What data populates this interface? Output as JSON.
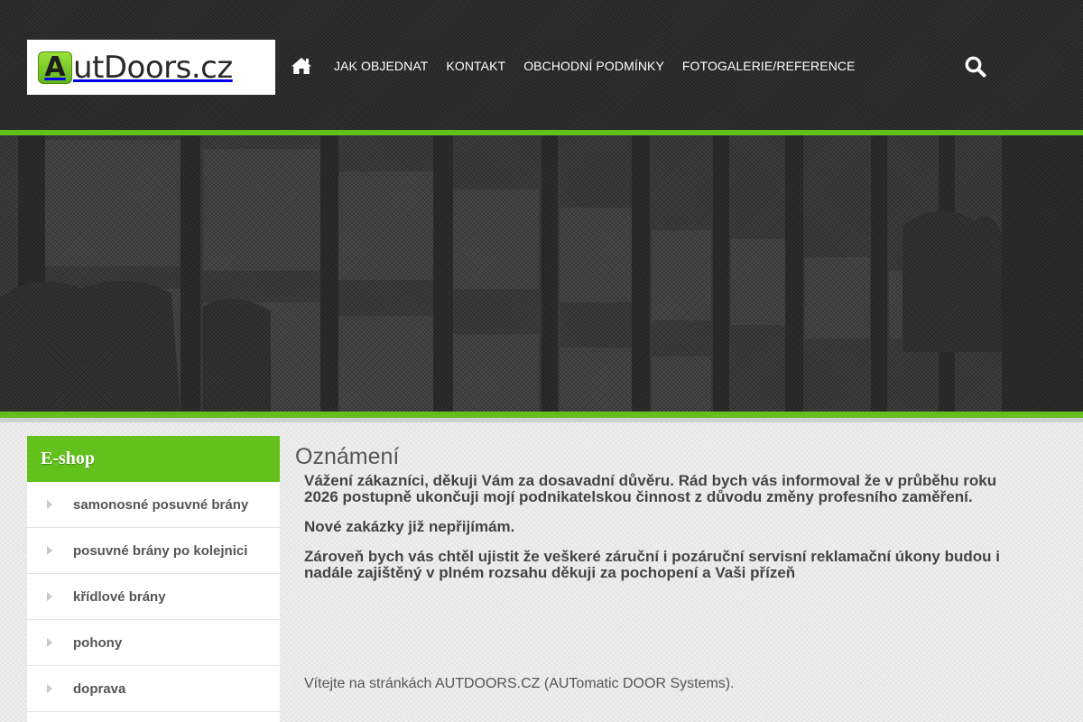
{
  "header": {
    "logo_letter": "A",
    "logo_text": "utDoors.cz",
    "nav": [
      {
        "label": "JAK OBJEDNAT"
      },
      {
        "label": "KONTAKT"
      },
      {
        "label": "OBCHODNÍ PODMÍNKY"
      },
      {
        "label": "FOTOGALERIE/REFERENCE"
      }
    ],
    "icons": {
      "home": "home-icon",
      "search": "search-icon"
    }
  },
  "sidebar": {
    "title": "E-shop",
    "items": [
      {
        "label": "samonosné posuvné brány"
      },
      {
        "label": "posuvné brány po kolejnici"
      },
      {
        "label": "křídlové brány"
      },
      {
        "label": "pohony"
      },
      {
        "label": "doprava"
      },
      {
        "label": ""
      }
    ]
  },
  "main": {
    "title": "Oznámení",
    "paragraphs": [
      "Vážení zákazníci, děkuji Vám za dosavadní důvěru. Rád bych vás informoval že v průběhu roku 2026 postupně ukončuji mojí podnikatelskou činnost z důvodu změny profesního zaměření.",
      "Nové zakázky již nepřijímám.",
      "Zároveň bych vás chtěl ujistit že veškeré záruční i pozáruční servisní reklamační úkony budou i nadále zajištěný v plném rozsahu děkuji za pochopení a Vaši přízeň"
    ],
    "welcome": "Vítejte na stránkách AUTDOORS.CZ (AUTomatic DOOR Systems)."
  },
  "colors": {
    "accent_green": "#62bf1e",
    "header_bg": "#2c2c2c",
    "text_dark": "#444444"
  }
}
